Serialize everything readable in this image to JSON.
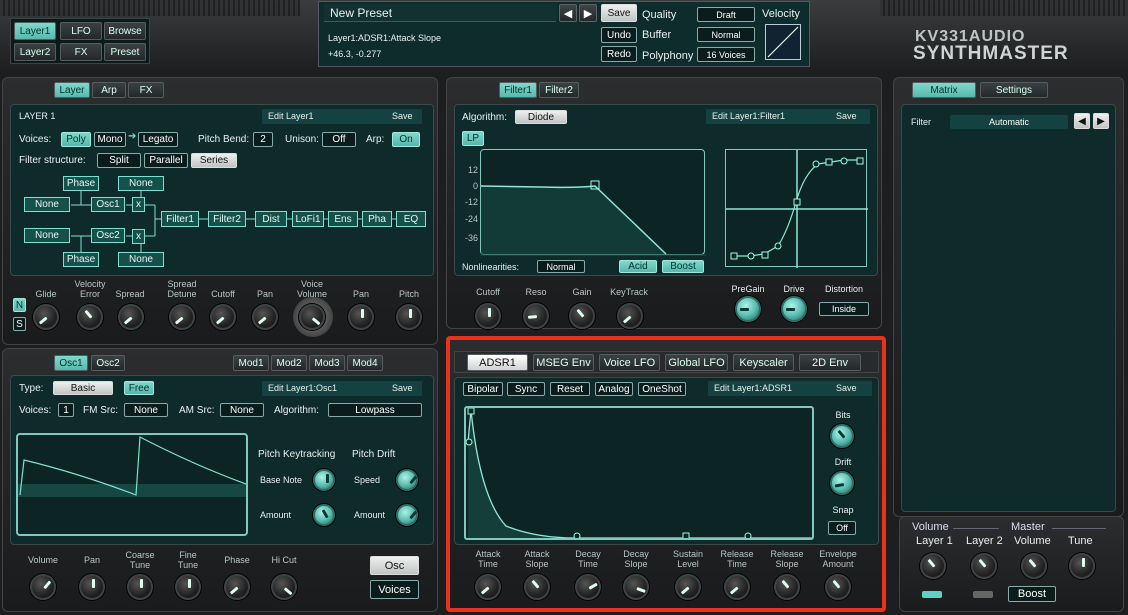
{
  "top_bar": {
    "left_tabs": [
      "Layer1",
      "LFO",
      "Browse",
      "Layer2",
      "FX",
      "Preset"
    ],
    "preset_name": "New Preset",
    "status_line1": "Layer1:ADSR1:Attack Slope",
    "status_line2": "+46.3, -0.277",
    "save": "Save",
    "undo": "Undo",
    "redo": "Redo",
    "quality_label": "Quality",
    "quality_value": "Draft",
    "buffer_label": "Buffer",
    "buffer_value": "Normal",
    "polyphony_label": "Polyphony",
    "polyphony_value": "16 Voices",
    "velocity_label": "Velocity",
    "logo_line1": "KV331AUDIO",
    "logo_line2": "SYNTHMASTER"
  },
  "layer_panel": {
    "tabs": [
      "Layer",
      "Arp",
      "FX"
    ],
    "title": "LAYER 1",
    "edit_label": "Edit Layer1",
    "save": "Save",
    "voices_label": "Voices:",
    "poly": "Poly",
    "mono": "Mono",
    "legato": "Legato",
    "pitch_bend_label": "Pitch Bend:",
    "pitch_bend_value": "2",
    "unison_label": "Unison:",
    "unison_value": "Off",
    "arp_label": "Arp:",
    "arp_value": "On",
    "filter_structure_label": "Filter structure:",
    "split": "Split",
    "parallel": "Parallel",
    "series": "Series",
    "routing": {
      "phase1": "Phase",
      "none_top": "None",
      "none1": "None",
      "osc1": "Osc1",
      "x1": "x",
      "none2": "None",
      "osc2": "Osc2",
      "x2": "x",
      "phase2": "Phase",
      "none_bottom": "None",
      "chain": [
        "Filter1",
        "Filter2",
        "Dist",
        "LoFi1",
        "Ens",
        "Pha",
        "EQ"
      ]
    },
    "knob_labels": [
      "Glide",
      "Velocity\nError",
      "Spread",
      "Spread\nDetune",
      "Cutoff",
      "Pan",
      "Voice\nVolume",
      "Pan",
      "Pitch"
    ],
    "n": "N",
    "s": "S"
  },
  "filter_panel": {
    "tabs": [
      "Filter1",
      "Filter2"
    ],
    "algorithm_label": "Algorithm:",
    "algorithm_value": "Diode",
    "edit_label": "Edit Layer1:Filter1",
    "save": "Save",
    "type": "LP",
    "y_ticks": [
      "12",
      "0",
      "-12",
      "-24",
      "-36"
    ],
    "nonlinearities_label": "Nonlinearities:",
    "nonlinearities_value": "Normal",
    "acid": "Acid",
    "boost": "Boost",
    "knob_labels": [
      "Cutoff",
      "Reso",
      "Gain",
      "KeyTrack"
    ],
    "pregain": "PreGain",
    "drive": "Drive",
    "distortion": "Distortion",
    "distortion_value": "Inside"
  },
  "matrix_panel": {
    "tabs": [
      "Matrix",
      "Settings"
    ],
    "filter_label": "Filter",
    "filter_value": "Automatic"
  },
  "osc_panel": {
    "tabs": [
      "Osc1",
      "Osc2"
    ],
    "mod_tabs": [
      "Mod1",
      "Mod2",
      "Mod3",
      "Mod4"
    ],
    "type_label": "Type:",
    "type_value": "Basic",
    "free": "Free",
    "edit_label": "Edit Layer1:Osc1",
    "save": "Save",
    "voices_label": "Voices:",
    "voices_value": "1",
    "fm_label": "FM Src:",
    "fm_value": "None",
    "am_label": "AM Src:",
    "am_value": "None",
    "algorithm_label": "Algorithm:",
    "algorithm_value": "Lowpass",
    "pitch_keytracking": "Pitch Keytracking",
    "pitch_drift": "Pitch Drift",
    "base_note": "Base Note",
    "amount": "Amount",
    "speed": "Speed",
    "amount2": "Amount",
    "knob_labels": [
      "Volume",
      "Pan",
      "Coarse\nTune",
      "Fine\nTune",
      "Phase",
      "Hi Cut"
    ],
    "osc_btn": "Osc",
    "voices_btn": "Voices"
  },
  "env_panel": {
    "tabs": [
      "ADSR1",
      "MSEG Env",
      "Voice LFO",
      "Global LFO",
      "Keyscaler",
      "2D Env"
    ],
    "bipolar": "Bipolar",
    "sync": "Sync",
    "reset": "Reset",
    "analog": "Analog",
    "oneshot": "OneShot",
    "edit_label": "Edit Layer1:ADSR1",
    "save": "Save",
    "bits": "Bits",
    "drift": "Drift",
    "snap": "Snap",
    "snap_value": "Off",
    "knob_labels": [
      "Attack\nTime",
      "Attack\nSlope",
      "Decay\nTime",
      "Decay\nSlope",
      "Sustain\nLevel",
      "Release\nTime",
      "Release\nSlope",
      "Envelope\nAmount"
    ]
  },
  "master_panel": {
    "volume_label": "Volume",
    "master_label": "Master",
    "layer1": "Layer 1",
    "layer2": "Layer 2",
    "volume": "Volume",
    "tune": "Tune",
    "boost": "Boost"
  },
  "highlight_color": "#e8321e",
  "accent_color": "#7fd8cc"
}
